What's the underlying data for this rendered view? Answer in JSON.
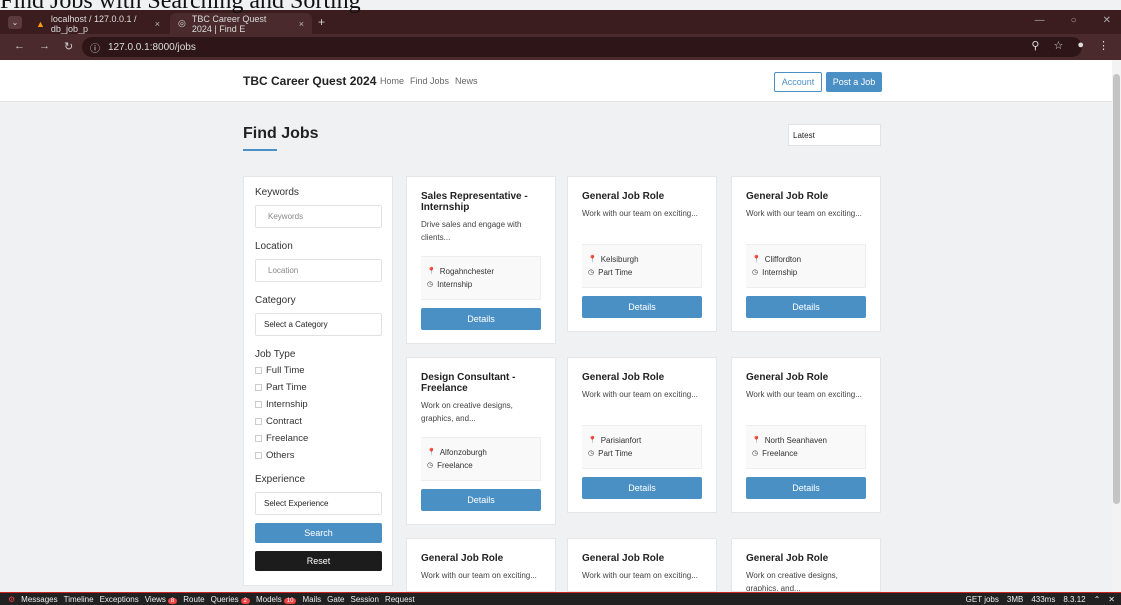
{
  "overlay_title": "Find Jobs with Searching and Sorting",
  "browser": {
    "tabs": [
      {
        "icon": "phpmyadmin-icon",
        "label": "localhost / 127.0.0.1 / db_job_p",
        "close": "×"
      },
      {
        "icon": "globe-icon",
        "label": "TBC Career Quest 2024 | Find E",
        "close": "×"
      }
    ],
    "new_tab": "+",
    "address": "127.0.0.1:8000/jobs"
  },
  "site": {
    "brand": "TBC Career Quest 2024",
    "nav": [
      "Home",
      "Find Jobs",
      "News"
    ],
    "account": "Account",
    "post_job": "Post a Job"
  },
  "page": {
    "title": "Find Jobs",
    "sort_value": "Latest"
  },
  "filters": {
    "keywords_label": "Keywords",
    "keywords_placeholder": "Keywords",
    "location_label": "Location",
    "location_placeholder": "Location",
    "category_label": "Category",
    "category_value": "Select a Category",
    "job_type_label": "Job Type",
    "job_types": [
      "Full Time",
      "Part Time",
      "Internship",
      "Contract",
      "Freelance",
      "Others"
    ],
    "experience_label": "Experience",
    "experience_value": "Select Experience",
    "search": "Search",
    "reset": "Reset"
  },
  "jobs": [
    {
      "title": "Sales Representative - Internship",
      "desc": "Drive sales and engage with clients...",
      "location": "Rogahnchester",
      "type": "Internship",
      "btn": "Details"
    },
    {
      "title": "General Job Role",
      "desc": "Work with our team on exciting...",
      "location": "Kelsiburgh",
      "type": "Part Time",
      "btn": "Details"
    },
    {
      "title": "General Job Role",
      "desc": "Work with our team on exciting...",
      "location": "Cliffordton",
      "type": "Internship",
      "btn": "Details"
    },
    {
      "title": "Design Consultant - Freelance",
      "desc": "Work on creative designs, graphics, and...",
      "location": "Alfonzoburgh",
      "type": "Freelance",
      "btn": "Details"
    },
    {
      "title": "General Job Role",
      "desc": "Work with our team on exciting...",
      "location": "Parisianfort",
      "type": "Part Time",
      "btn": "Details"
    },
    {
      "title": "General Job Role",
      "desc": "Work with our team on exciting...",
      "location": "North Seanhaven",
      "type": "Freelance",
      "btn": "Details"
    },
    {
      "title": "General Job Role",
      "desc": "Work with our team on exciting..."
    },
    {
      "title": "General Job Role",
      "desc": "Work with our team on exciting..."
    },
    {
      "title": "General Job Role",
      "desc": "Work on creative designs, graphics, and..."
    }
  ],
  "debugbar": {
    "items": [
      "Messages",
      "Timeline",
      "Exceptions",
      "Views",
      "Route",
      "Queries",
      "Models",
      "Mails",
      "Gate",
      "Session",
      "Request"
    ],
    "badges": {
      "views": "8",
      "queries": "2",
      "models": "10"
    },
    "right": [
      "GET jobs",
      "3MB",
      "433ms",
      "8.3.12"
    ]
  }
}
